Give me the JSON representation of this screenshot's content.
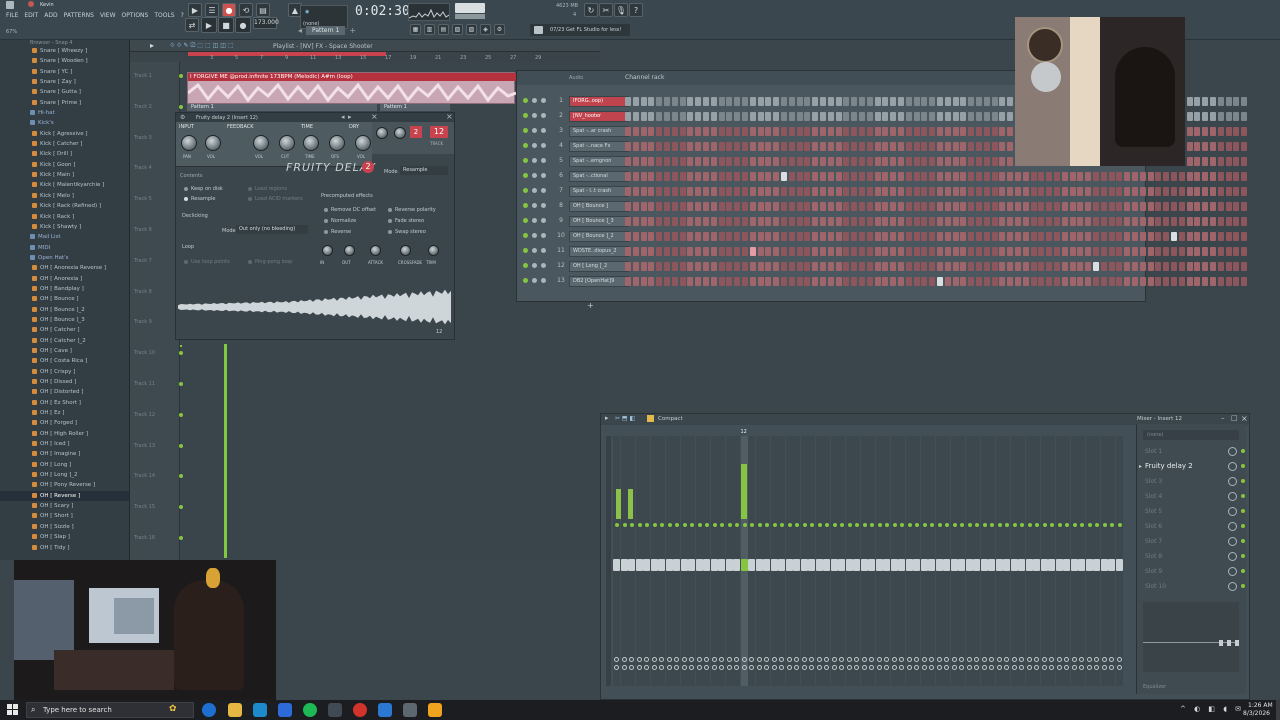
{
  "app": {
    "user": "Kevin",
    "menu": [
      "FILE",
      "EDIT",
      "ADD",
      "PATTERNS",
      "VIEW",
      "OPTIONS",
      "TOOLS",
      "?"
    ],
    "time": "0:02:30",
    "tempo": "173.000",
    "pattern": "Pattern 1",
    "cpu_label": "4623 MB",
    "cpu_value": "4",
    "hint_text": "07/23  Get FL Studio for less!",
    "zoom": "67%"
  },
  "browser": {
    "header": "Browser - Snap 4",
    "items": [
      {
        "label": "Snare [ Wheezy ]",
        "folder": false
      },
      {
        "label": "Snare [ Wooden ]",
        "folder": false
      },
      {
        "label": "Snare [ YC ]",
        "folder": false
      },
      {
        "label": "Snare [ Zay ]",
        "folder": false
      },
      {
        "label": "Snare [ Gutta ]",
        "folder": false
      },
      {
        "label": "Snare [ Prime ]",
        "folder": false
      },
      {
        "label": "Hi-hat",
        "folder": true
      },
      {
        "label": "Kick's",
        "folder": true
      },
      {
        "label": "Kick [ Agressive ]",
        "folder": false
      },
      {
        "label": "Kick [ Catcher ]",
        "folder": false
      },
      {
        "label": "Kick [ Drill ]",
        "folder": false
      },
      {
        "label": "Kick [ Goon ]",
        "folder": false
      },
      {
        "label": "Kick [ Main ]",
        "folder": false
      },
      {
        "label": "Kick [ Malentikyarchie ]",
        "folder": false
      },
      {
        "label": "Kick [ Melo ]",
        "folder": false
      },
      {
        "label": "Kick [ Rack (Refined) ]",
        "folder": false
      },
      {
        "label": "Kick [ Rack ]",
        "folder": false
      },
      {
        "label": "Kick [ Shawty ]",
        "folder": false
      },
      {
        "label": "Mail List",
        "folder": true
      },
      {
        "label": "MIDI",
        "folder": true
      },
      {
        "label": "Open Hat's",
        "folder": true
      },
      {
        "label": "OH [ Anorexia Reverse ]",
        "folder": false
      },
      {
        "label": "OH [ Anorexia ]",
        "folder": false
      },
      {
        "label": "OH [ Bandplay ]",
        "folder": false
      },
      {
        "label": "OH [ Bounce ]",
        "folder": false
      },
      {
        "label": "OH [ Bounce ]_2",
        "folder": false
      },
      {
        "label": "OH [ Bounce ]_3",
        "folder": false
      },
      {
        "label": "OH [ Catcher ]",
        "folder": false
      },
      {
        "label": "OH [ Catcher ]_2",
        "folder": false
      },
      {
        "label": "OH [ Cave ]",
        "folder": false
      },
      {
        "label": "OH [ Costa Rica ]",
        "folder": false
      },
      {
        "label": "OH [ Crispy ]",
        "folder": false
      },
      {
        "label": "OH [ Dissed ]",
        "folder": false
      },
      {
        "label": "OH [ Distorted ]",
        "folder": false
      },
      {
        "label": "OH [ Ez Short ]",
        "folder": false
      },
      {
        "label": "OH [ Ez ]",
        "folder": false
      },
      {
        "label": "OH [ Forged ]",
        "folder": false
      },
      {
        "label": "OH [ High Roller ]",
        "folder": false
      },
      {
        "label": "OH [ Iced ]",
        "folder": false
      },
      {
        "label": "OH [ Imagine ]",
        "folder": false
      },
      {
        "label": "OH [ Long ]",
        "folder": false
      },
      {
        "label": "OH [ Long ]_2",
        "folder": false
      },
      {
        "label": "OH [ Pony Reverse ]",
        "folder": false
      },
      {
        "label": "OH [ Reverse ]",
        "folder": false,
        "selected": true
      },
      {
        "label": "OH [ Scary ]",
        "folder": false
      },
      {
        "label": "OH [ Short ]",
        "folder": false
      },
      {
        "label": "OH [ Sizzle ]",
        "folder": false
      },
      {
        "label": "OH [ Slap ]",
        "folder": false
      },
      {
        "label": "OH [ Tidy ]",
        "folder": false
      }
    ]
  },
  "playlist": {
    "title": "Playlist - [NV] FX - Space Shooter",
    "clip_title": "I FORGIVE ME @prod.infinite 173BPM (Melodic) A#m (loop)",
    "pattern1": "Pattern 1",
    "pattern2": "Pattern 1",
    "tracks": [
      "Track 1",
      "Track 2",
      "Track 3",
      "Track 4",
      "Track 5",
      "Track 6",
      "Track 7",
      "Track 8",
      "Track 9",
      "Track 10",
      "Track 11",
      "Track 12",
      "Track 13",
      "Track 14",
      "Track 15",
      "Track 16"
    ]
  },
  "delay": {
    "title": "Fruity delay 2 (Insert 12)",
    "name": "FRUITY DELAY",
    "version": "2",
    "sections": [
      "INPUT",
      "FEEDBACK",
      "TIME",
      "DRY"
    ],
    "knob_labels": [
      "PAN",
      "VOL",
      "VOL",
      "CUT",
      "TIME",
      "OFS",
      "VOL"
    ],
    "track_label": "TRACK",
    "track_value": "12",
    "mode_label": "Mode",
    "mode_value": "Resample",
    "contents": "Contents",
    "keep_on_disk": "Keep on disk",
    "resample": "Resample",
    "load_regions": "Load regions",
    "load_acid": "Load ACID markers",
    "declicking": "Declicking",
    "declick_mode_label": "Mode",
    "declick_mode_value": "Out only (no bleeding)",
    "precomputed": "Precomputed effects",
    "remove_dc": "Remove DC offset",
    "normalize": "Normalize",
    "reverse": "Reverse",
    "reverse_polarity": "Reverse polarity",
    "fade_stereo": "Fade stereo",
    "swap_stereo": "Swap stereo",
    "loop": "Loop",
    "use_loop_points": "Use loop points",
    "ping_pong": "Ping-pong loop",
    "bottom_knobs": [
      "IN",
      "OUT",
      "ATTACK",
      "CROSSFADE",
      "TRIM"
    ],
    "footer_value": "12"
  },
  "channel_rack": {
    "title": "Channel rack",
    "filter": "Audio",
    "channels": [
      {
        "num": "1",
        "name": "IFORG..oop)",
        "hl": true
      },
      {
        "num": "2",
        "name": "[NV_hooter",
        "hl": true
      },
      {
        "num": "3",
        "name": "Spat -..ar crash",
        "hl": false
      },
      {
        "num": "4",
        "name": "Spat -..nace Fx",
        "hl": false
      },
      {
        "num": "5",
        "name": "Spat -..emgnon",
        "hl": false
      },
      {
        "num": "6",
        "name": "Spat -..ctional",
        "hl": false
      },
      {
        "num": "7",
        "name": "Spat - I..t crash",
        "hl": false
      },
      {
        "num": "8",
        "name": "OH [ Bounce ]",
        "hl": false
      },
      {
        "num": "9",
        "name": "OH [ Bounce ]_3",
        "hl": false
      },
      {
        "num": "10",
        "name": "OH [ Bounce ]_2",
        "hl": false
      },
      {
        "num": "11",
        "name": "WDSTE..diopus_2",
        "hl": false
      },
      {
        "num": "12",
        "name": "OH [ Long ]_2",
        "hl": false
      },
      {
        "num": "13",
        "name": "DB2 [OpenHat]9",
        "hl": false
      }
    ]
  },
  "mixer": {
    "view": "Compact",
    "insert_title": "Mixer - Insert 12",
    "selected_insert": "12",
    "slots": [
      {
        "label": "Slot 1",
        "active": false
      },
      {
        "label": "Fruity delay 2",
        "active": true
      },
      {
        "label": "Slot 3",
        "active": false
      },
      {
        "label": "Slot 4",
        "active": false
      },
      {
        "label": "Slot 5",
        "active": false
      },
      {
        "label": "Slot 6",
        "active": false
      },
      {
        "label": "Slot 7",
        "active": false
      },
      {
        "label": "Slot 8",
        "active": false
      },
      {
        "label": "Slot 9",
        "active": false
      },
      {
        "label": "Slot 10",
        "active": false
      }
    ],
    "equalizer": "Equalizer"
  },
  "taskbar": {
    "search_placeholder": "Type here to search",
    "time": "1:26 AM",
    "date": "8/3/2026"
  },
  "colors": {
    "accent_green": "#86c540",
    "accent_red": "#c0444d",
    "panel": "#46535a"
  }
}
